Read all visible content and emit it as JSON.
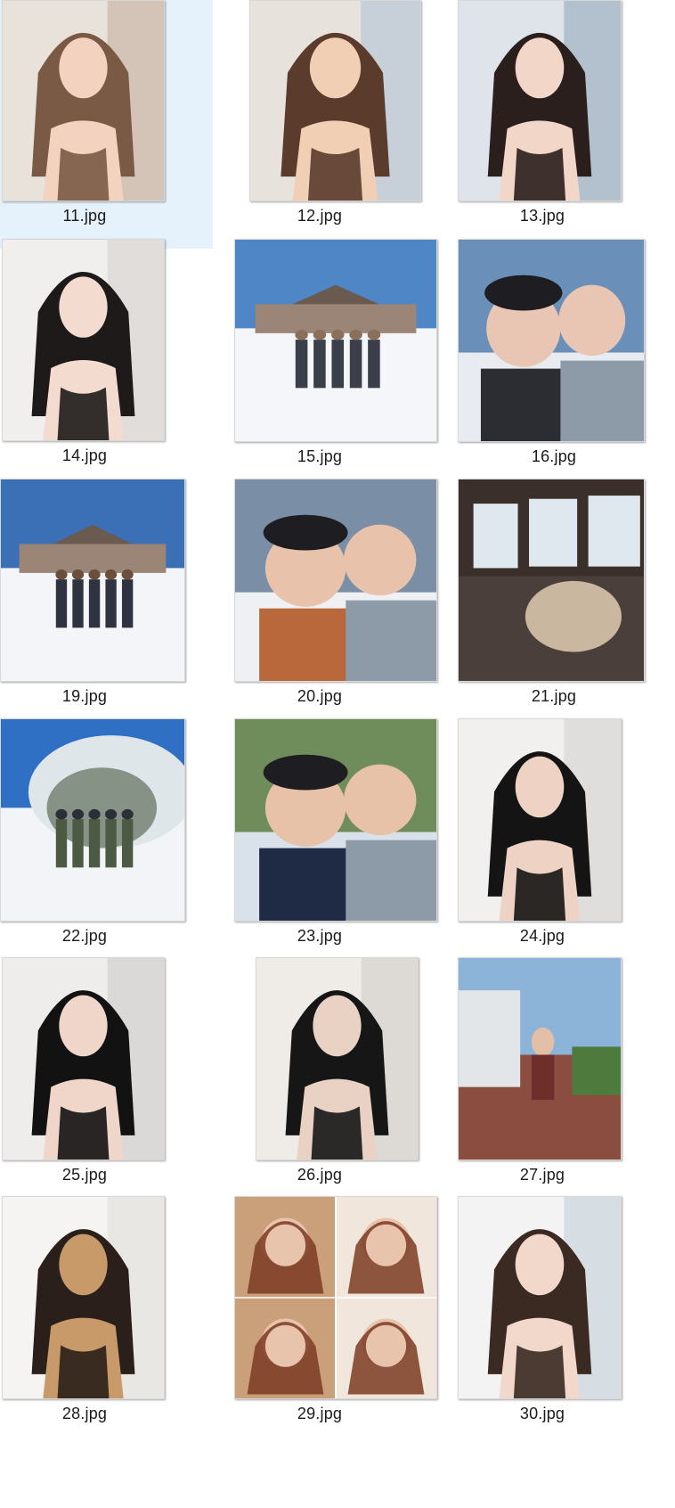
{
  "view": {
    "name": "file-thumbnail-grid",
    "selected_index": 0
  },
  "files": [
    {
      "name": "11.jpg",
      "scene": "indoor-portrait",
      "palette": [
        "#c9b8a8",
        "#e9e2da",
        "#7a5a44",
        "#f3d3c0"
      ]
    },
    {
      "name": "12.jpg",
      "scene": "indoor-portrait",
      "palette": [
        "#b9c9d6",
        "#e7e2dc",
        "#5a3b2c",
        "#f0cfb5"
      ]
    },
    {
      "name": "13.jpg",
      "scene": "indoor-portrait",
      "palette": [
        "#9fb0c0",
        "#dfe4ea",
        "#2a1f1c",
        "#f2d6c8"
      ]
    },
    {
      "name": "14.jpg",
      "scene": "indoor-portrait",
      "palette": [
        "#d9d6d3",
        "#f1efee",
        "#1e1a1a",
        "#f3dbcf"
      ]
    },
    {
      "name": "15.jpg",
      "scene": "snow-group",
      "palette": [
        "#4f86c6",
        "#f4f6fa",
        "#3a3f4a",
        "#8a6f5a"
      ]
    },
    {
      "name": "16.jpg",
      "scene": "snow-selfie",
      "palette": [
        "#6a8fb8",
        "#e8ecf1",
        "#2b2d33",
        "#e9c6b4"
      ]
    },
    {
      "name": "19.jpg",
      "scene": "snow-group",
      "palette": [
        "#3b6fb6",
        "#f3f5f8",
        "#2f3340",
        "#6b4f3c"
      ]
    },
    {
      "name": "20.jpg",
      "scene": "snow-selfie",
      "palette": [
        "#7a8ea6",
        "#eef0f3",
        "#b9683c",
        "#e8c2ab"
      ]
    },
    {
      "name": "21.jpg",
      "scene": "train-window",
      "palette": [
        "#3a2f2a",
        "#dfe7ef",
        "#6b6e75",
        "#c9b79f"
      ]
    },
    {
      "name": "22.jpg",
      "scene": "snow-trees",
      "palette": [
        "#2f6fc4",
        "#f2f4f7",
        "#4d5a43",
        "#2c2f38"
      ]
    },
    {
      "name": "23.jpg",
      "scene": "outdoor-selfie",
      "palette": [
        "#6f8d5a",
        "#d9e2ea",
        "#1f2a45",
        "#e8c2a8"
      ]
    },
    {
      "name": "24.jpg",
      "scene": "indoor-portrait",
      "palette": [
        "#d8d6d4",
        "#f2f0ee",
        "#141414",
        "#eed3c4"
      ]
    },
    {
      "name": "25.jpg",
      "scene": "indoor-portrait",
      "palette": [
        "#d2d0ce",
        "#efedeb",
        "#121212",
        "#f0d6c8"
      ]
    },
    {
      "name": "26.jpg",
      "scene": "indoor-portrait",
      "palette": [
        "#d6d3cf",
        "#efece8",
        "#161616",
        "#e9d2c3"
      ]
    },
    {
      "name": "27.jpg",
      "scene": "outdoor-street",
      "palette": [
        "#8bb4d8",
        "#e3e6e9",
        "#6e2f2a",
        "#4e7a3e"
      ]
    },
    {
      "name": "28.jpg",
      "scene": "indoor-portrait",
      "palette": [
        "#e4e1dd",
        "#f6f4f2",
        "#2a1f1a",
        "#c89a6a"
      ]
    },
    {
      "name": "29.jpg",
      "scene": "collage",
      "palette": [
        "#c9a07a",
        "#f1e6dc",
        "#7b3a22",
        "#e9c4ad"
      ]
    },
    {
      "name": "30.jpg",
      "scene": "indoor-portrait",
      "palette": [
        "#c9d3dc",
        "#f3f3f3",
        "#3a2a22",
        "#f1d8ca"
      ]
    }
  ]
}
